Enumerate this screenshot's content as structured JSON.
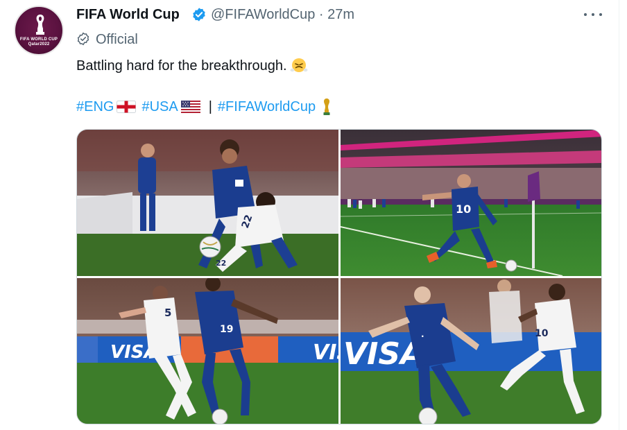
{
  "tweet": {
    "author_name": "FIFA World Cup",
    "handle": "@FIFAWorldCup",
    "time_sep": "·",
    "time": "27m",
    "label": "Official",
    "text": "Battling hard for the breakthrough.",
    "emoji": "face-with-steam-from-nose",
    "hashtags": [
      {
        "text": "#ENG",
        "flag": "england-flag"
      },
      {
        "text": "#USA",
        "flag": "usa-flag"
      },
      {
        "text": "#FIFAWorldCup",
        "flag": "trophy"
      }
    ],
    "separator": "|"
  },
  "avatar": {
    "brand_line1": "FIFA WORLD CUP",
    "brand_line2": "Qatar2022"
  },
  "photos": [
    {
      "numbers": [
        "22"
      ]
    },
    {
      "numbers": [
        "10"
      ]
    },
    {
      "numbers": [
        "5",
        "19"
      ],
      "boards": [
        "VISA",
        "VISA"
      ]
    },
    {
      "numbers": [
        "10"
      ],
      "boards": [
        "VISA"
      ]
    }
  ],
  "colors": {
    "link": "#1d9bf0",
    "verified": "#1d9bf0",
    "secondary_text": "#536471",
    "usa_kit": "#1b3d8f",
    "eng_kit": "#f4f4f4",
    "pitch": "#3f7d2a",
    "avatar_bg": "#5b1240"
  }
}
